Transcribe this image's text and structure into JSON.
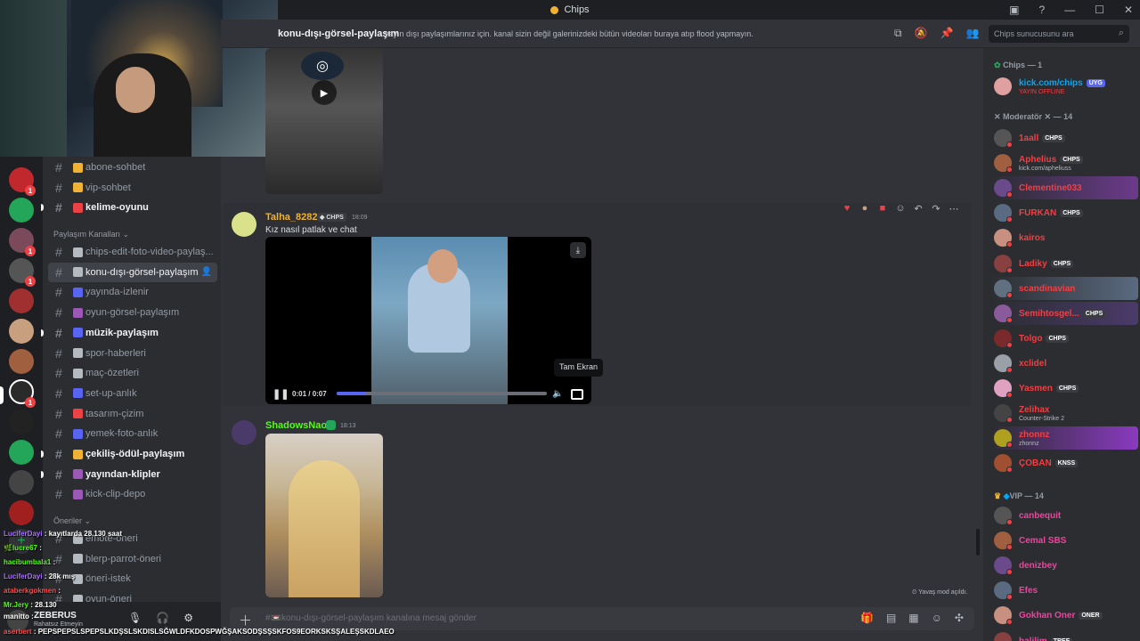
{
  "window": {
    "title": "Chips"
  },
  "channel": {
    "name": "konu-dışı-görsel-paylaşım",
    "topic": "yayın dışı paylaşımlarınız için. kanal sizin değil galerinizdeki bütün videoları buraya atıp flood yapmayın.",
    "search_placeholder": "Chips sunucusunu ara"
  },
  "sidebar": {
    "channels": [
      {
        "label": "abone-sohbet",
        "state": "normal",
        "emoji_color": "#f0b232"
      },
      {
        "label": "vip-sohbet",
        "state": "normal",
        "emoji_color": "#f0b232"
      },
      {
        "label": "kelime-oyunu",
        "state": "unread",
        "emoji_color": "#ed4245"
      }
    ],
    "category_share": "Paylaşım Kanalları",
    "share_channels": [
      {
        "label": "chips-edit-foto-video-paylaş...",
        "state": "normal",
        "emoji_color": "#b5bac1"
      },
      {
        "label": "konu-dışı-görsel-paylaşım",
        "state": "active",
        "emoji_color": "#b5bac1"
      },
      {
        "label": "yayında-izlenir",
        "state": "normal",
        "emoji_color": "#5865f2"
      },
      {
        "label": "oyun-görsel-paylaşım",
        "state": "normal",
        "emoji_color": "#9b59b6"
      },
      {
        "label": "müzik-paylaşım",
        "state": "unread",
        "emoji_color": "#5865f2"
      },
      {
        "label": "spor-haberleri",
        "state": "normal",
        "emoji_color": "#b5bac1"
      },
      {
        "label": "maç-özetleri",
        "state": "normal",
        "emoji_color": "#b5bac1"
      },
      {
        "label": "set-up-anlık",
        "state": "normal",
        "emoji_color": "#5865f2"
      },
      {
        "label": "tasarım-çizim",
        "state": "normal",
        "emoji_color": "#ed4245"
      },
      {
        "label": "yemek-foto-anlık",
        "state": "normal",
        "emoji_color": "#5865f2"
      },
      {
        "label": "çekiliş-ödül-paylaşım",
        "state": "unread",
        "emoji_color": "#f0b232"
      },
      {
        "label": "yayından-klipler",
        "state": "unread",
        "emoji_color": "#9b59b6"
      },
      {
        "label": "kick-clip-depo",
        "state": "normal",
        "emoji_color": "#9b59b6"
      }
    ],
    "category_suggest": "Öneriler",
    "suggest_channels": [
      {
        "label": "emote-öneri",
        "state": "normal",
        "emoji_color": "#b5bac1"
      },
      {
        "label": "blerp-parrot-öneri",
        "state": "normal",
        "emoji_color": "#b5bac1"
      },
      {
        "label": "öneri-istek",
        "state": "normal",
        "emoji_color": "#b5bac1"
      },
      {
        "label": "oyun-öneri",
        "state": "normal",
        "emoji_color": "#b5bac1"
      }
    ]
  },
  "user_panel": {
    "username": "ZEBERUS",
    "status": "Rahatsız Etmeyin"
  },
  "chat_overlay": [
    {
      "user": "LuciferDayi",
      "text": ": kayıtlarda 28.130 saat",
      "color": "#a970ff"
    },
    {
      "user": "🌿lucre67",
      "text": ":",
      "color": "#53fc18"
    },
    {
      "user": "hacibumbala1",
      "text": ":",
      "color": "#53fc18"
    },
    {
      "user": "LuciferDayi",
      "text": ": 28k mış",
      "color": "#a970ff"
    },
    {
      "user": "ataberkgokmen",
      "text": ":",
      "color": "#ff4d4d"
    },
    {
      "user": "Mr.Jery",
      "text": ": 28.130",
      "color": "#53fc18"
    },
    {
      "user": "manitto",
      "text": ":",
      "color": "#ffffff"
    },
    {
      "user": "aserbert",
      "text": ": PEPSPEPSLSPEPSLKDŞSLSKDISLSĞWLDFKDOSPWĞŞAKSODŞSŞSKFOS9EORKSKSŞALEŞSKDLAEO",
      "color": "#ff4d4d"
    }
  ],
  "messages": [
    {
      "author": "Talha_8282",
      "author_color": "#f0b232",
      "tag": "CHPS",
      "time": "18:09",
      "text": "Kız nasıl patlak ve chat",
      "video": {
        "current": "0:01",
        "duration": "0:07",
        "progress": 0.14
      },
      "tooltip": "Tam Ekran"
    },
    {
      "author": "ShadowsNaoe",
      "author_color": "#53fc18",
      "time": "18:13"
    }
  ],
  "slowmode": "Yavaş mod açıldı.",
  "composer": {
    "placeholder": "#📼konu-dışı-görsel-paylaşım kanalına mesaj gönder"
  },
  "members": {
    "group_owner": "Chips — 1",
    "owner": {
      "name": "kick.com/chips",
      "tag": "UYG",
      "sub": "YAYIN OFFLINE",
      "color": "#00a8fc"
    },
    "group_mod": "✕ Moderatör ✕ — 14",
    "mods": [
      {
        "name": "1aall",
        "tag": "CHPS",
        "sub": "",
        "color": "#f23f43",
        "boost": ""
      },
      {
        "name": "Aphelius",
        "tag": "CHPS",
        "sub": "kick.com/apheliuss",
        "color": "#f23f43",
        "boost": ""
      },
      {
        "name": "Clementine033",
        "tag": "",
        "sub": "",
        "color": "#f23f43",
        "boost": "#6b3a8a"
      },
      {
        "name": "FURKAN",
        "tag": "CHPS",
        "sub": "",
        "color": "#f23f43",
        "boost": ""
      },
      {
        "name": "kairos",
        "tag": "",
        "sub": "",
        "color": "#f23f43",
        "boost": ""
      },
      {
        "name": "Ladiky",
        "tag": "CHPS",
        "sub": "",
        "color": "#f23f43",
        "boost": ""
      },
      {
        "name": "scandinavian",
        "tag": "",
        "sub": "",
        "color": "#f23f43",
        "boost": "#5a6a80"
      },
      {
        "name": "Semihtosgel...",
        "tag": "CHPS",
        "sub": "",
        "color": "#f23f43",
        "boost": "#4a3a6a"
      },
      {
        "name": "Tolgo",
        "tag": "CHPS",
        "sub": "",
        "color": "#f23f43",
        "boost": ""
      },
      {
        "name": "xclidel",
        "tag": "",
        "sub": "",
        "color": "#f23f43",
        "boost": ""
      },
      {
        "name": "Yasmen",
        "tag": "CHPS",
        "sub": "",
        "color": "#f23f43",
        "boost": ""
      },
      {
        "name": "Zelihax",
        "tag": "",
        "sub": "Counter-Strike 2",
        "color": "#f23f43",
        "boost": ""
      },
      {
        "name": "zhonnz",
        "tag": "",
        "sub": "zhonnz",
        "color": "#f23f43",
        "boost": "#8a3ac0"
      },
      {
        "name": "ÇOBAN",
        "tag": "KNSS",
        "sub": "",
        "color": "#f23f43",
        "boost": ""
      }
    ],
    "group_vip": "VIP — 14",
    "vips": [
      {
        "name": "canbequit",
        "tag": "",
        "color": "#eb459e"
      },
      {
        "name": "Cemal SBS",
        "tag": "",
        "color": "#eb459e"
      },
      {
        "name": "denizbey",
        "tag": "",
        "color": "#eb459e"
      },
      {
        "name": "Efes",
        "tag": "",
        "color": "#eb459e"
      },
      {
        "name": "Gokhan Oner",
        "tag": "ONER",
        "color": "#eb459e"
      },
      {
        "name": "halilim",
        "tag": "TREF",
        "color": "#eb459e"
      }
    ]
  }
}
